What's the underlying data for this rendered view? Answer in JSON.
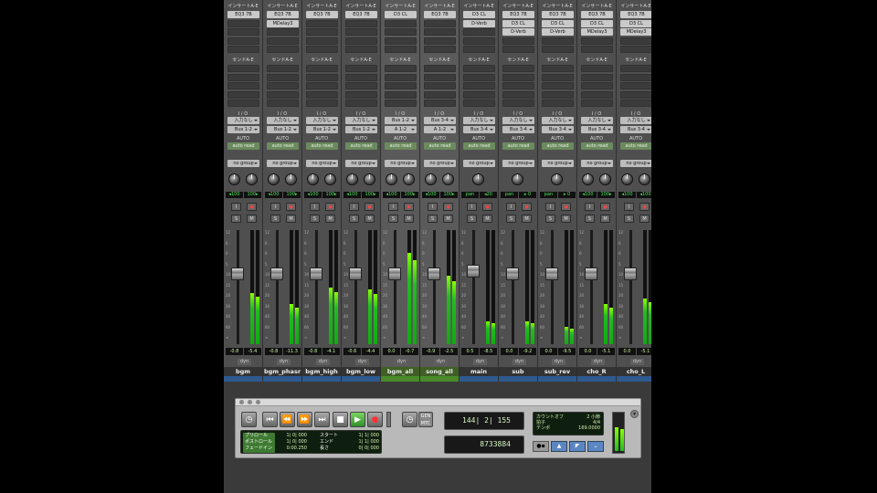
{
  "headers": {
    "inserts": "インサートA-E",
    "sends": "センドA-E",
    "io": "I / O",
    "auto": "AUTO",
    "dyn": "dyn"
  },
  "strips": [
    {
      "name": "bgm",
      "inserts": [
        "EQ3 7B"
      ],
      "input": "入力なし",
      "output": "Bus 1-2",
      "automation": "auto read",
      "group": "no group",
      "pan_l": "◂100",
      "pan_r": "100▸",
      "vol": "-0.8",
      "peak": "-5.4",
      "meter": 0.45,
      "fader": 0.62,
      "aux": false
    },
    {
      "name": "bgm_phasr",
      "inserts": [
        "EQ3 7B",
        "MDelay3"
      ],
      "input": "入力なし",
      "output": "Bus 1-2",
      "automation": "auto read",
      "group": "no group",
      "pan_l": "◂100",
      "pan_r": "100▸",
      "vol": "-0.8",
      "peak": "-11.3",
      "meter": 0.35,
      "fader": 0.62,
      "aux": false
    },
    {
      "name": "bgm_high",
      "inserts": [
        "EQ3 7B"
      ],
      "input": "入力なし",
      "output": "Bus 1-2",
      "automation": "auto read",
      "group": "no group",
      "pan_l": "◂100",
      "pan_r": "100▸",
      "vol": "-0.8",
      "peak": "-4.1",
      "meter": 0.5,
      "fader": 0.62,
      "aux": false
    },
    {
      "name": "bgm_low",
      "inserts": [
        "EQ3 7B"
      ],
      "input": "入力なし",
      "output": "Bus 1-2",
      "automation": "auto read",
      "group": "no group",
      "pan_l": "◂100",
      "pan_r": "100▸",
      "vol": "-0.6",
      "peak": "-4.4",
      "meter": 0.48,
      "fader": 0.62,
      "aux": false
    },
    {
      "name": "bgm_all",
      "inserts": [
        "D3 CL"
      ],
      "input": "Bus 1-2",
      "output": "A 1-2",
      "automation": "auto read",
      "group": "no group",
      "pan_l": "◂100",
      "pan_r": "100▸",
      "vol": "0.0",
      "peak": "-0.7",
      "meter": 0.8,
      "fader": 0.62,
      "aux": true
    },
    {
      "name": "song_all",
      "inserts": [
        "EQ3 7B"
      ],
      "input": "Bus 3-4",
      "output": "A 1-2",
      "automation": "auto read",
      "group": "no group",
      "pan_l": "◂100",
      "pan_r": "100▸",
      "vol": "-0.9",
      "peak": "-2.5",
      "meter": 0.6,
      "fader": 0.62,
      "aux": true
    },
    {
      "name": "main",
      "inserts": [
        "D3 CL",
        "D-Verb"
      ],
      "input": "入力なし",
      "output": "Bus 3-4",
      "automation": "auto read",
      "group": "no group",
      "pan_l": "pan",
      "pan_r": "◂20",
      "vol": "0.5",
      "peak": "-8.5",
      "meter": 0.2,
      "fader": 0.64,
      "aux": false
    },
    {
      "name": "sub",
      "inserts": [
        "EQ3 7B",
        "D3 CL",
        "D-Verb"
      ],
      "input": "入力なし",
      "output": "Bus 3-4",
      "automation": "auto read",
      "group": "no group",
      "pan_l": "pan",
      "pan_r": "▸ 0",
      "vol": "0.0",
      "peak": "-9.2",
      "meter": 0.2,
      "fader": 0.62,
      "aux": false
    },
    {
      "name": "sub_rev",
      "inserts": [
        "EQ3 7B",
        "D3 CL",
        "D-Verb"
      ],
      "input": "入力なし",
      "output": "Bus 3-4",
      "automation": "auto read",
      "group": "no group",
      "pan_l": "pan",
      "pan_r": "▸ 0",
      "vol": "0.0",
      "peak": "-9.5",
      "meter": 0.15,
      "fader": 0.62,
      "aux": false
    },
    {
      "name": "cho_R",
      "inserts": [
        "EQ3 7B",
        "D3 CL",
        "MDelay3"
      ],
      "input": "入力なし",
      "output": "Bus 3-4",
      "automation": "auto read",
      "group": "no group",
      "pan_l": "◂100",
      "pan_r": "100▸",
      "vol": "0.0",
      "peak": "-5.1",
      "meter": 0.35,
      "fader": 0.62,
      "aux": false
    },
    {
      "name": "cho_L",
      "inserts": [
        "EQ3 7B",
        "D3 CL",
        "MDelay3"
      ],
      "input": "入力なし",
      "output": "Bus 3-4",
      "automation": "auto read",
      "group": "no group",
      "pan_l": "◂100",
      "pan_r": "◂100",
      "vol": "0.0",
      "peak": "-5.1",
      "meter": 0.4,
      "fader": 0.62,
      "aux": false
    }
  ],
  "transport": {
    "main_counter": "144| 2| 155",
    "sub_counter": "8733884",
    "gen_label": "GEN",
    "mtc_label": "MTC",
    "preroll_label": "プリロール",
    "preroll_val": "1| 0| 000",
    "postroll_label": "ポストロール",
    "postroll_val": "1| 0| 000",
    "fade_label": "フェードイン",
    "fade_val": "0:00.250",
    "start_label": "スタート",
    "start_val": "1| 1| 000",
    "end_label": "エンド",
    "end_val": "1| 1| 000",
    "len_label": "長さ",
    "len_val": "0| 0| 000",
    "countoff": "カウントオフ",
    "countoff_val": "2 小節",
    "meter_label": "拍子",
    "meter_val": "4/4",
    "tempo_label": "テンポ",
    "tempo_val": "169.0000"
  }
}
